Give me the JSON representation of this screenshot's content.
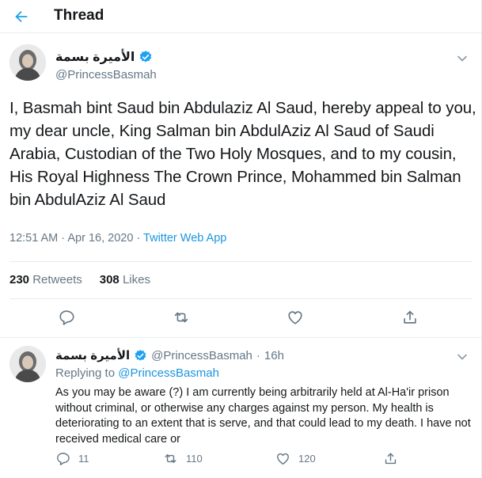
{
  "header": {
    "title": "Thread"
  },
  "main_tweet": {
    "display_name": "الأميرة بسمة",
    "handle": "@PrincessBasmah",
    "text": "I, Basmah bint Saud bin Abdulaziz Al Saud, hereby appeal to you, my dear uncle, King Salman bin AbdulAziz Al Saud of Saudi Arabia, Custodian of the Two Holy Mosques, and to my cousin, His Royal Highness The Crown Prince, Mohammed bin Salman bin AbdulAziz Al Saud",
    "time": "12:51 AM",
    "date": "Apr 16, 2020",
    "source": "Twitter Web App",
    "retweets_count": "230",
    "retweets_label": "Retweets",
    "likes_count": "308",
    "likes_label": "Likes"
  },
  "reply_tweet": {
    "display_name": "الأميرة بسمة",
    "handle": "@PrincessBasmah",
    "age": "16h",
    "replying_to_label": "Replying to",
    "replying_to_handle": "@PrincessBasmah",
    "text": "As you may be aware (?) I am currently being arbitrarily held at Al-Ha'ir prison without criminal, or otherwise any charges against my person. My health is deteriorating to an extent that is serve, and that could lead to my death. I have not received medical care or",
    "reply_count": "11",
    "retweet_count": "110",
    "like_count": "120"
  },
  "colors": {
    "accent": "#1da1f2",
    "link": "#1b95e0",
    "muted": "#657786",
    "text": "#14171a"
  },
  "icons": [
    "back-arrow-icon",
    "verified-badge-icon",
    "chevron-down-icon",
    "reply-icon",
    "retweet-icon",
    "like-icon",
    "share-icon"
  ]
}
